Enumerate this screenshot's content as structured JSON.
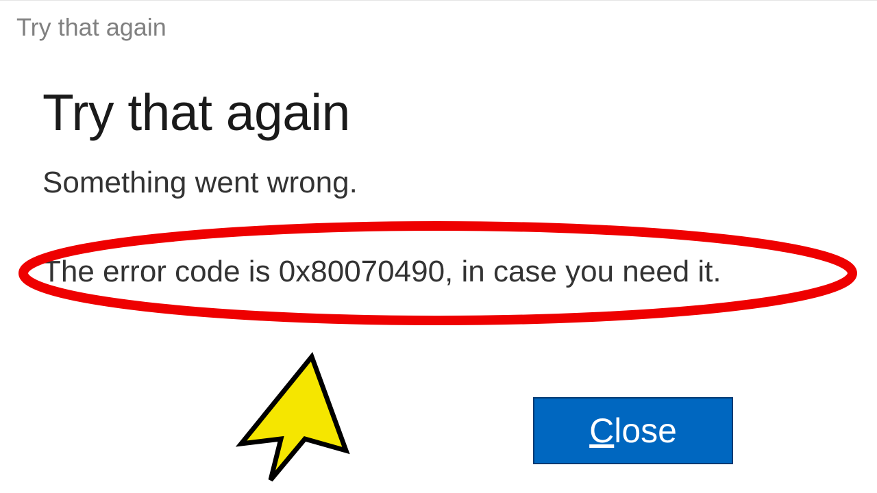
{
  "titlebar": {
    "title": "Try that again"
  },
  "dialog": {
    "heading": "Try that again",
    "subtext": "Something went wrong.",
    "error_message": "The error code is 0x80070490, in case you need it."
  },
  "buttons": {
    "close_accesskey": "C",
    "close_rest": "lose"
  },
  "annotation": {
    "highlight_color": "#ee0000",
    "cursor_fill": "#f5e600",
    "cursor_stroke": "#000000"
  }
}
